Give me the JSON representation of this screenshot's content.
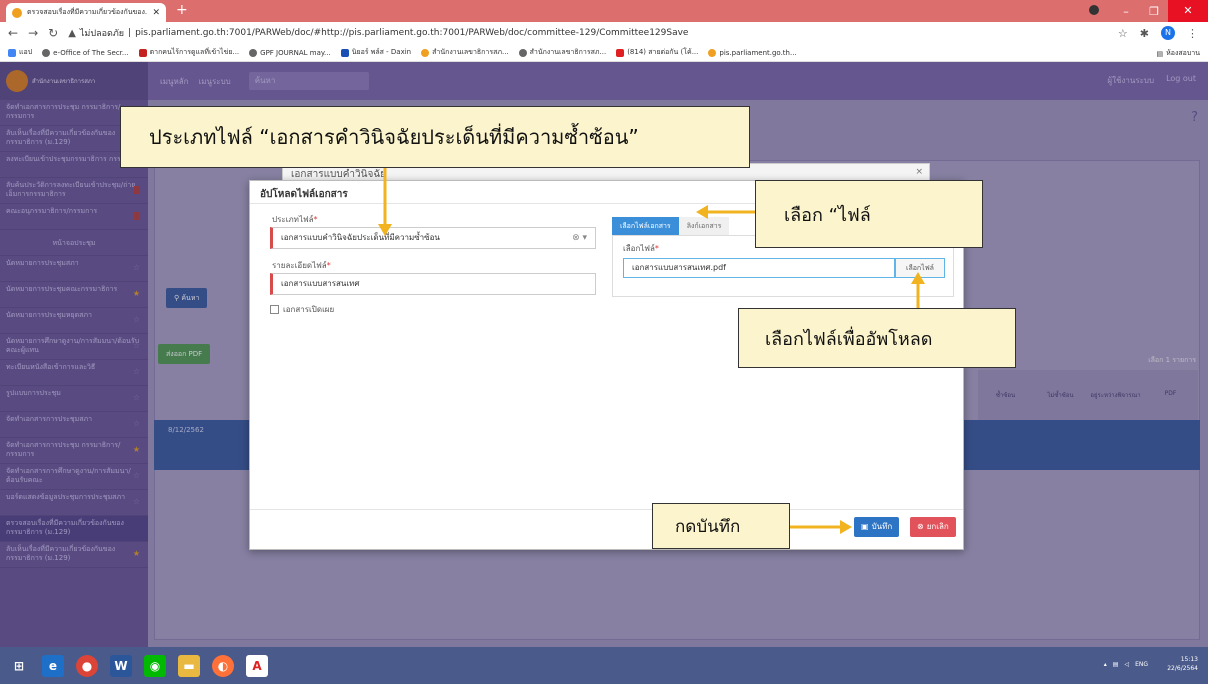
{
  "browser": {
    "tab_title": "ตรวจสอบเรื่องที่มีความเกี่ยวข้องกันของ...",
    "url_warning": "ไม่ปลอดภัย",
    "url": "pis.parliament.go.th:7001/PARWeb/doc/#http://pis.parliament.go.th:7001/PARWeb/doc/committee-129/Committee129Save",
    "profile_initial": "N",
    "bookmarks": [
      "แอป",
      "e-Office of The Secr...",
      "ตากคนไร้การดูแลที่เข้าไข่ย...",
      "GPF JOURNAL may...",
      "นิยอร์ พล์ส - Daxin",
      "สำนักงานเลขาธิการสภ...",
      "สำนักงานเลขาธิการสภ...",
      "(814) สายต่อกัน (โค้...",
      "pis.parliament.go.th..."
    ],
    "reading_list": "ห้องสอบาน"
  },
  "app": {
    "logo_text": "สำนักงานเลขาธิการสภา",
    "menu": [
      "เมนูหลัก",
      "เมนูระบบ"
    ],
    "search_placeholder": "ค้นหา",
    "header_right": [
      "ผู้ใช้งานระบบ",
      "Log out"
    ]
  },
  "sidebar": {
    "items": [
      "จัดทำเอกสารการประชุม กรรมาธิการ/กรรมการ",
      "ลับเห็นเรื่องที่มีความเกี่ยวข้องกันของกรรมาธิการ (ม.129)",
      "ลงทะเบียนเข้าประชุมกรรมาธิการ กรรมการ",
      "ลับค้นประวัติการลงทะเบียนเข้าประชุม/ถ่ายเอ็มการกรรมาธิการ",
      "คณะอนุกรรมาธิการ/กรรมการ",
      "หน้าจอประชุม",
      "นัดหมายการประชุมสภา",
      "นัดหมายการประชุมคณะกรรมาธิการ",
      "นัดหมายการประชุมหยุดสภา",
      "นัดหมายการศึกษาดูงาน/การสัมมนา/ต้อนรับคณะผู้แทน",
      "ทะเบียนหนังสือเข้าการและวิธี",
      "รูปแบบการประชุม",
      "จัดทำเอกสารการประชุมสภา",
      "จัดทำเอกสารการประชุม กรรมาธิการ/กรรมการ",
      "จัดทำเอกสารการศึกษาดูงาน/การสัมมนา/ต้อนรับคณะ",
      "บอร์ดแสดงข้อมูลประชุมการประชุมสภา",
      "ตรวจสอบเรื่องที่มีความเกี่ยวข้องกันของกรรมาธิการ (ม.129)",
      "ลับเห็นเรื่องที่มีความเกี่ยวข้องกันของกรรมาธิการ (ม.129)"
    ]
  },
  "main": {
    "search_button": "ค้นหา",
    "pdf_button": "ส่งออก PDF",
    "result_count": "เลือก 1 รายการ",
    "table_headers": [
      "ซ้ำซ้อน",
      "ไม่ซ้ำซ้อน",
      "อยู่ระหว่างพิจารณา",
      "PDF"
    ],
    "row_date": "8/12/2562"
  },
  "background_dialog": {
    "title": "เอกสารแบบคำวินิจฉัย"
  },
  "modal": {
    "title": "อัปโหลดไฟล์เอกสาร",
    "file_type_label": "ประเภทไฟล์",
    "file_type_value": "เอกสารแบบคำวินิจฉัยประเด็นที่มีความซ้ำซ้อน",
    "file_detail_label": "รายละเอียดไฟล์",
    "file_detail_value": "เอกสารแบบสารสนเทศ",
    "publish_checkbox": "เอกสารเปิดเผย",
    "tab_select_file": "เลือกไฟล์เอกสาร",
    "tab_other": "ลิงก์เอกสาร",
    "select_file_label": "เลือกไฟล์",
    "selected_file": "เอกสารแบบสารสนเทศ.pdf",
    "browse_button": "เลือกไฟล์",
    "save_button": "บันทึก",
    "cancel_button": "ยกเลิก",
    "required_mark": "*"
  },
  "callouts": {
    "file_type": "ประเภทไฟล์ “เอกสารคำวินิจฉัยประเด็นที่มีความซ้ำซ้อน”",
    "choose_tab": "เลือก “ไฟล์",
    "choose_file": "เลือกไฟล์เพื่ออัพโหลด",
    "press_save": "กดบันทึก"
  },
  "taskbar": {
    "lang": "ENG",
    "time": "15:13",
    "date": "22/6/2564"
  },
  "colors": {
    "callout_bg": "#fbf4cc",
    "arrow": "#f2b320",
    "primary": "#2d74c4",
    "danger": "#e2525a",
    "app_purple": "#7b68a8"
  }
}
